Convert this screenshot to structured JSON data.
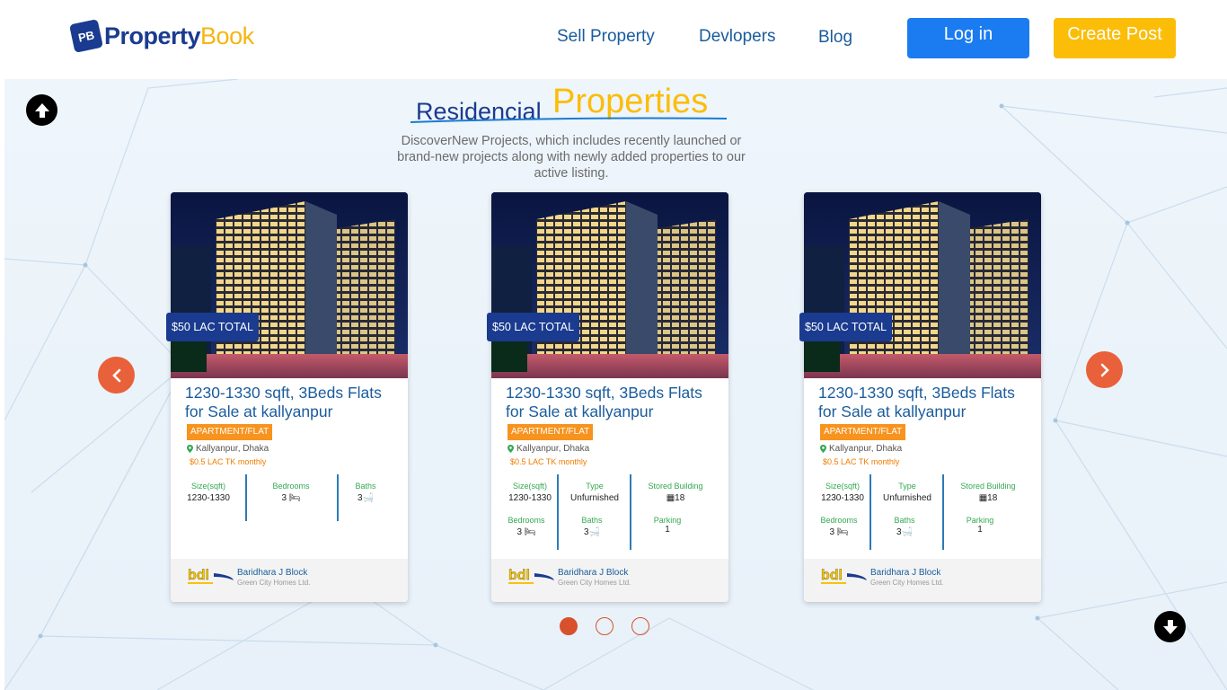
{
  "brand": {
    "part1": "Property",
    "part2": "Book",
    "mark": "PB"
  },
  "nav": {
    "sell": "Sell Property",
    "developers": "Devlopers",
    "blog": "Blog"
  },
  "auth": {
    "login": "Log in",
    "create_post": "Create Post"
  },
  "section": {
    "title_part1": "Residencial",
    "title_part2": "Properties",
    "subtitle": "DiscoverNew Projects, which includes recently launched or brand-new projects along with newly added properties to our active listing."
  },
  "cards": [
    {
      "price": "$50 LAC TOTAL",
      "title": "1230-1330 sqft, 3Beds Flats for Sale at kallyanpur",
      "badge": "APARTMENT/FLAT",
      "location": "Kallyanpur, Dhaka",
      "monthly": "$0.5 LAC TK monthly",
      "stats": {
        "size_label": "Size(sqft)",
        "size_value": "1230-1330",
        "bedrooms_label": "Bedrooms",
        "bedrooms_value": "3",
        "baths_label": "Baths",
        "baths_value": "3"
      },
      "developer": {
        "name": "Baridhara J Block",
        "sub": "Green City Homes Ltd.",
        "logo": "bdl"
      }
    },
    {
      "price": "$50 LAC TOTAL",
      "title": "1230-1330 sqft, 3Beds Flats for Sale at kallyanpur",
      "badge": "APARTMENT/FLAT",
      "location": "Kallyanpur, Dhaka",
      "monthly": "$0.5 LAC TK monthly",
      "stats": {
        "size_label": "Size(sqft)",
        "size_value": "1230-1330",
        "type_label": "Type",
        "type_value": "Unfurnished",
        "stored_label": "Stored Building",
        "stored_value": "18",
        "bedrooms_label": "Bedrooms",
        "bedrooms_value": "3",
        "baths_label": "Baths",
        "baths_value": "3",
        "parking_label": "Parking",
        "parking_value": "1"
      },
      "developer": {
        "name": "Baridhara J Block",
        "sub": "Green City Homes Ltd.",
        "logo": "bdl"
      }
    },
    {
      "price": "$50 LAC TOTAL",
      "title": "1230-1330 sqft, 3Beds Flats for Sale at kallyanpur",
      "badge": "APARTMENT/FLAT",
      "location": "Kallyanpur, Dhaka",
      "monthly": "$0.5 LAC TK monthly",
      "stats": {
        "size_label": "Size(sqft)",
        "size_value": "1230-1330",
        "type_label": "Type",
        "type_value": "Unfurnished",
        "stored_label": "Stored Building",
        "stored_value": "18",
        "bedrooms_label": "Bedrooms",
        "bedrooms_value": "3",
        "baths_label": "Baths",
        "baths_value": "3",
        "parking_label": "Parking",
        "parking_value": "1"
      },
      "developer": {
        "name": "Baridhara J Block",
        "sub": "Green City Homes Ltd.",
        "logo": "bdl"
      }
    }
  ],
  "carousel": {
    "pages": 3,
    "active_page": 1
  },
  "colors": {
    "brand_blue": "#1a3b8f",
    "brand_yellow": "#fbbd08",
    "accent_orange": "#e8613a",
    "login_blue": "#1a7cf0"
  },
  "icons": [
    "arrow-up-icon",
    "arrow-down-icon",
    "chevron-left-icon",
    "chevron-right-icon",
    "location-pin-icon",
    "bed-icon",
    "bath-icon",
    "building-icon"
  ]
}
